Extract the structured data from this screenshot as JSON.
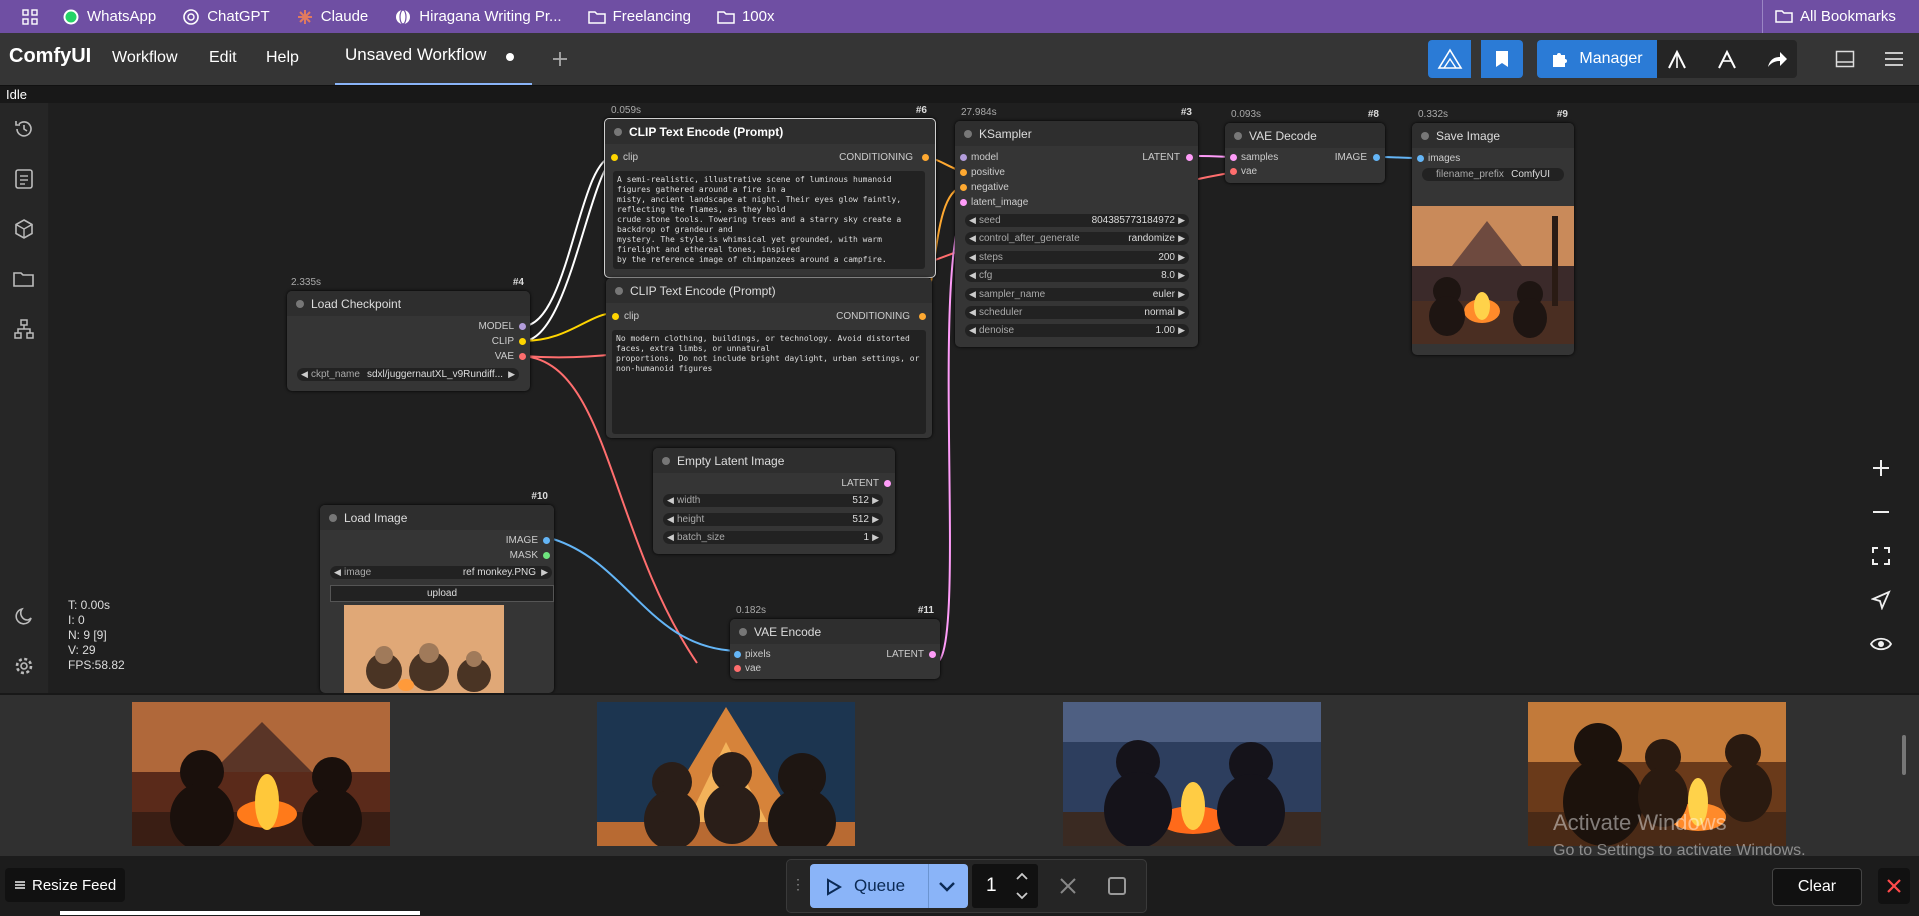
{
  "bookmarks": {
    "items": [
      "WhatsApp",
      "ChatGPT",
      "Claude",
      "Hiragana Writing Pr...",
      "Freelancing",
      "100x"
    ],
    "all": "All Bookmarks"
  },
  "header": {
    "logo": "ComfyUI",
    "menus": [
      "Workflow",
      "Edit",
      "Help"
    ],
    "tab_label": "Unsaved Workflow",
    "manager_label": "Manager"
  },
  "status": "Idle",
  "nodes": {
    "clip_pos": {
      "time": "0.059s",
      "id": "#6",
      "title": "CLIP Text Encode (Prompt)",
      "input": "clip",
      "output": "CONDITIONING",
      "text": "A semi-realistic, illustrative scene of luminous humanoid figures gathered around a fire in a\nmisty, ancient landscape at night. Their eyes glow faintly, reflecting the flames, as they hold\ncrude stone tools. Towering trees and a starry sky create a backdrop of grandeur and\nmystery. The style is whimsical yet grounded, with warm firelight and ethereal tones, inspired\nby the reference image of chimpanzees around a campfire."
    },
    "clip_neg": {
      "title": "CLIP Text Encode (Prompt)",
      "input": "clip",
      "output": "CONDITIONING",
      "text": "No modern clothing, buildings, or technology. Avoid distorted faces, extra limbs, or unnatural\nproportions. Do not include bright daylight, urban settings, or non-humanoid figures"
    },
    "ksampler": {
      "time": "27.984s",
      "id": "#3",
      "title": "KSampler",
      "inputs": [
        "model",
        "positive",
        "negative",
        "latent_image"
      ],
      "output": "LATENT",
      "widgets": [
        {
          "label": "seed",
          "value": "804385773184972"
        },
        {
          "label": "control_after_generate",
          "value": "randomize"
        },
        {
          "label": "steps",
          "value": "200"
        },
        {
          "label": "cfg",
          "value": "8.0"
        },
        {
          "label": "sampler_name",
          "value": "euler"
        },
        {
          "label": "scheduler",
          "value": "normal"
        },
        {
          "label": "denoise",
          "value": "1.00"
        }
      ]
    },
    "vae_decode": {
      "time": "0.093s",
      "id": "#8",
      "title": "VAE Decode",
      "inputs": [
        "samples",
        "vae"
      ],
      "output": "IMAGE"
    },
    "save_image": {
      "time": "0.332s",
      "id": "#9",
      "title": "Save Image",
      "input": "images",
      "prefix_label": "filename_prefix",
      "prefix_value": "ComfyUI"
    },
    "load_checkpoint": {
      "time": "2.335s",
      "id": "#4",
      "title": "Load Checkpoint",
      "outputs": [
        "MODEL",
        "CLIP",
        "VAE"
      ],
      "widget_label": "ckpt_name",
      "widget_value": "sdxl/juggernautXL_v9Rundiff..."
    },
    "empty_latent": {
      "title": "Empty Latent Image",
      "output": "LATENT",
      "widgets": [
        {
          "label": "width",
          "value": "512"
        },
        {
          "label": "height",
          "value": "512"
        },
        {
          "label": "batch_size",
          "value": "1"
        }
      ]
    },
    "load_image": {
      "id": "#10",
      "title": "Load Image",
      "outputs": [
        "IMAGE",
        "MASK"
      ],
      "widget_label": "image",
      "widget_value": "ref monkey.PNG",
      "upload": "upload"
    },
    "vae_encode": {
      "time": "0.182s",
      "id": "#11",
      "title": "VAE Encode",
      "inputs": [
        "pixels",
        "vae"
      ],
      "output": "LATENT"
    }
  },
  "stats": {
    "t": "T: 0.00s",
    "i": "I: 0",
    "n": "N: 9 [9]",
    "v": "V: 29",
    "fps": "FPS:58.82"
  },
  "bottom": {
    "resize_feed": "Resize Feed",
    "queue_label": "Queue",
    "queue_count": "1",
    "clear": "Clear"
  },
  "watermark": {
    "line1": "Activate Windows",
    "line2": "Go to Settings to activate Windows."
  },
  "colors": {
    "accent": "#2b7bd6",
    "queue": "#8ab4f8",
    "bookmark_bar": "#6f4fa3",
    "wire_model": "#b39ddb",
    "wire_clip": "#ffd500",
    "wire_vae": "#ff6e6e",
    "wire_conditioning": "#ffa931",
    "wire_latent": "#ff9cf9",
    "wire_image": "#64b5f6"
  }
}
